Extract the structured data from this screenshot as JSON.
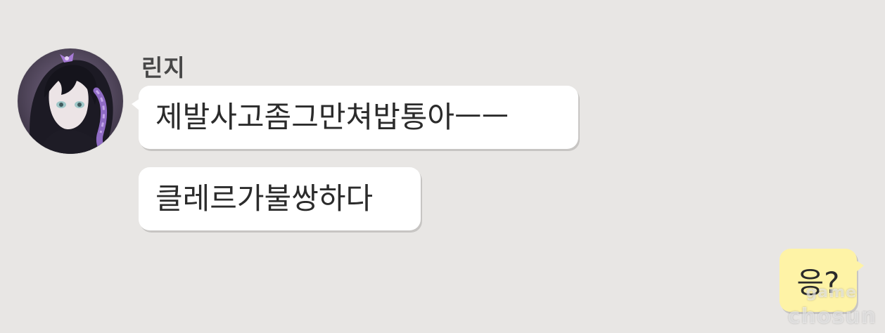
{
  "chat": {
    "sender": {
      "name": "린지",
      "avatar_icon": "anime-girl-avatar-icon"
    },
    "incoming_messages": [
      {
        "text": "제발사고좀그만쳐밥통아ㅡㅡ"
      },
      {
        "text": "클레르가불쌍하다"
      }
    ],
    "outgoing_messages": [
      {
        "text": "응?"
      }
    ]
  },
  "watermark": {
    "line1": "game",
    "line2": "chosun"
  },
  "colors": {
    "background": "#e8e6e4",
    "incoming_bubble": "#ffffff",
    "outgoing_bubble": "#fef3a6",
    "text": "#2b2b2b",
    "name_text": "#474747"
  }
}
